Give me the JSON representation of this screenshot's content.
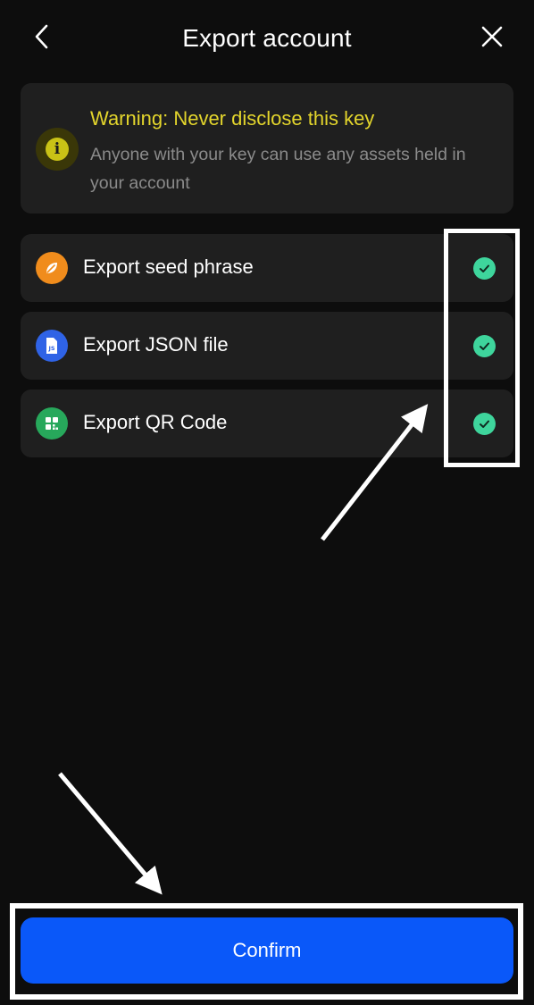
{
  "header": {
    "title": "Export account",
    "back_icon": "chevron-left-icon",
    "close_icon": "close-icon"
  },
  "warning": {
    "icon": "info-icon",
    "title": "Warning: Never disclose this key",
    "text": "Anyone with your key can use any assets held in your account",
    "title_color": "#e3d52c"
  },
  "options": [
    {
      "label": "Export seed phrase",
      "icon": "leaf-icon",
      "icon_color": "#f08c1c",
      "checked": true
    },
    {
      "label": "Export JSON file",
      "icon": "json-file-icon",
      "icon_color": "#2f63e6",
      "checked": true
    },
    {
      "label": "Export QR Code",
      "icon": "qr-code-icon",
      "icon_color": "#27a85b",
      "checked": true
    }
  ],
  "confirm": {
    "label": "Confirm",
    "color": "#0a58f9"
  },
  "colors": {
    "background": "#0d0d0d",
    "card": "#1f1f1f",
    "check": "#3ed59c"
  }
}
